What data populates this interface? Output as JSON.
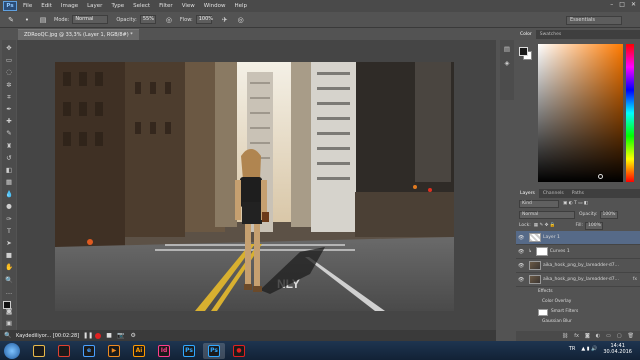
{
  "app": {
    "logo": "Ps"
  },
  "menu": [
    "File",
    "Edit",
    "Image",
    "Layer",
    "Type",
    "Select",
    "Filter",
    "View",
    "Window",
    "Help"
  ],
  "window_controls": [
    "–",
    "□",
    "✕"
  ],
  "options": {
    "mode_label": "Mode:",
    "mode_value": "Normal",
    "opacity_label": "Opacity:",
    "opacity_value": "55%",
    "flow_label": "Flow:",
    "flow_value": "100%",
    "workspace": "Essentials"
  },
  "document": {
    "tab": "ZDRooQC.jpg @ 33,3% (Layer 1, RGB/8#) *"
  },
  "color_panel": {
    "tabs": [
      "Color",
      "Swatches"
    ],
    "accent": "#ff7a00"
  },
  "layers_panel": {
    "tabs": [
      "Layers",
      "Channels",
      "Paths"
    ],
    "kind": "Kind",
    "blend_mode": "Normal",
    "opacity_label": "Opacity:",
    "opacity_value": "100%",
    "lock_label": "Lock:",
    "fill_label": "Fill:",
    "fill_value": "100%",
    "layers": [
      {
        "name": "Layer 1"
      },
      {
        "name": "Curves 1"
      },
      {
        "name": "aika_hosk_png_by_lareadder-d7..."
      },
      {
        "name": "aika_hosk_png_by_lareadder-d7..."
      }
    ],
    "fx_label": "fx",
    "effects": [
      "Effects",
      "Color Overlay",
      "Smart Filters",
      "Gaussian Blur"
    ]
  },
  "status": {
    "recording": "Kaydediliyor... [00:02:28]"
  },
  "taskbar": {
    "apps": [
      {
        "label": "",
        "icon": "explorer-icon",
        "color": "#e8b84a"
      },
      {
        "label": "",
        "icon": "chrome-icon",
        "color": "#e04030"
      },
      {
        "label": "e",
        "icon": "ie-icon",
        "color": "#4aa0ff"
      },
      {
        "label": "▶",
        "icon": "media-player-icon",
        "color": "#f08a20"
      },
      {
        "label": "Ai",
        "icon": "illustrator-icon",
        "color": "#ff9a00"
      },
      {
        "label": "Id",
        "icon": "indesign-icon",
        "color": "#ff3d8a"
      },
      {
        "label": "Ps",
        "icon": "photoshop-icon",
        "color": "#31a8ff"
      },
      {
        "label": "Ps",
        "icon": "photoshop-active-icon",
        "color": "#31a8ff"
      },
      {
        "label": "●",
        "icon": "recorder-icon",
        "color": "#e02020"
      }
    ],
    "language": "TR",
    "time": "14:41",
    "date": "30.04.2016"
  }
}
